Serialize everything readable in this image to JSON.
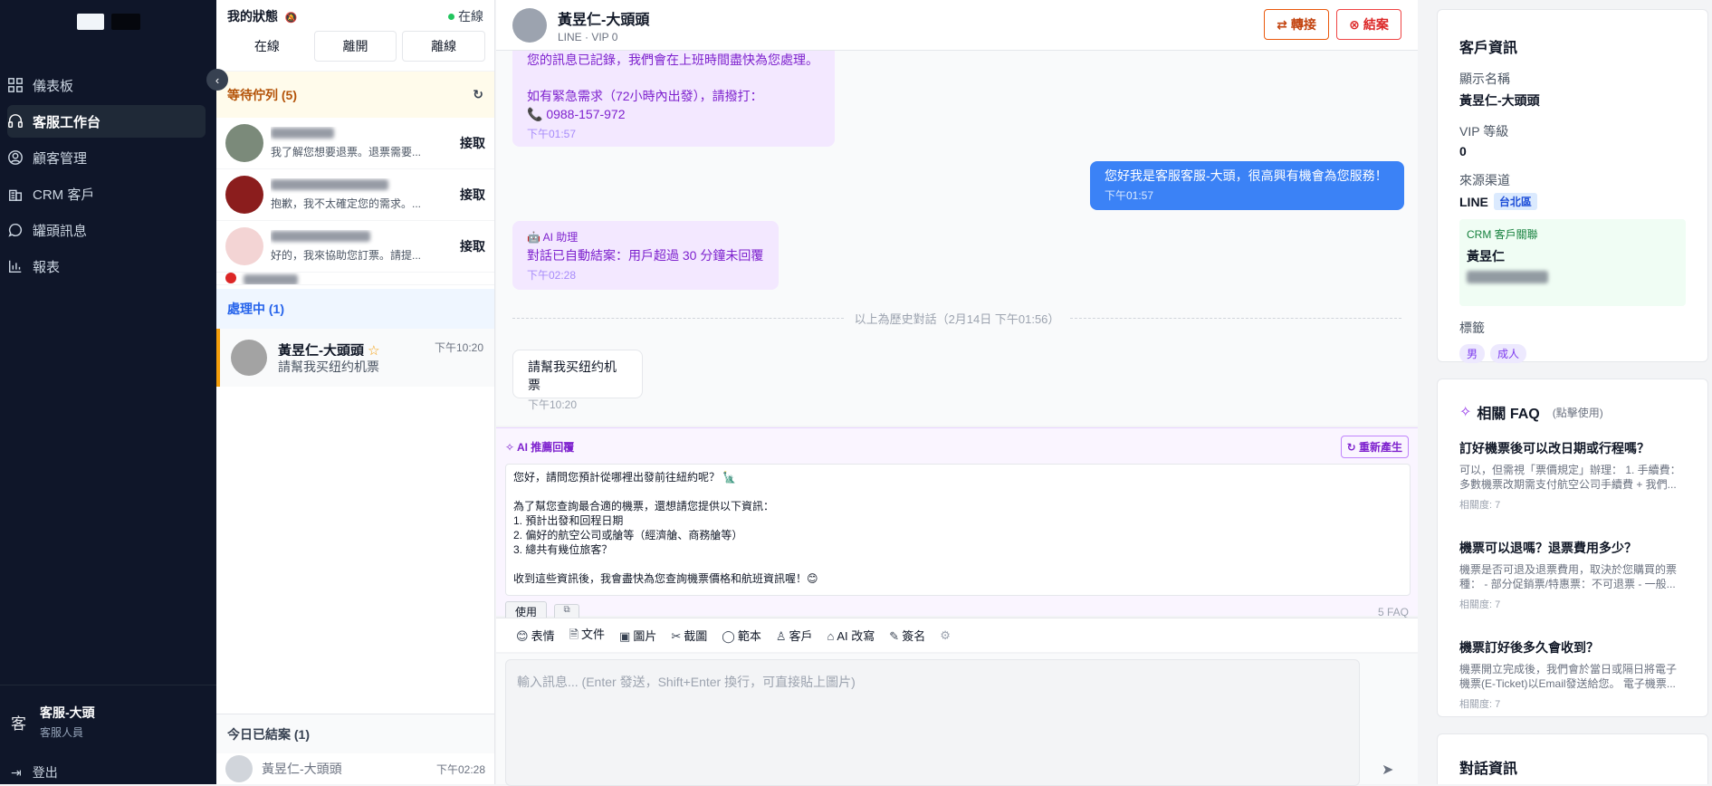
{
  "nav": {
    "items": [
      {
        "label": "儀表板",
        "icon": "dashboard-icon"
      },
      {
        "label": "客服工作台",
        "icon": "headset-icon"
      },
      {
        "label": "顧客管理",
        "icon": "user-circle-icon"
      },
      {
        "label": "CRM 客戶",
        "icon": "building-icon"
      },
      {
        "label": "罐頭訊息",
        "icon": "chat-bubble-icon"
      },
      {
        "label": "報表",
        "icon": "bar-chart-icon"
      }
    ],
    "agent": {
      "avatar_char": "客",
      "name": "客服-大頭",
      "role": "客服人員"
    },
    "logout_label": "登出"
  },
  "queue": {
    "status_label": "我的狀態",
    "online_label": "在線",
    "status_buttons": [
      "在線",
      "離開",
      "離線"
    ],
    "waiting_title": "等待佇列 (5)",
    "waiting": [
      {
        "message": "我了解您想要退票。退票需要...",
        "action": "接取"
      },
      {
        "message": "抱歉，我不太確定您的需求。...",
        "action": "接取"
      },
      {
        "message": "好的，我來協助您訂票。請提...",
        "action": "接取"
      }
    ],
    "processing_title": "處理中 (1)",
    "processing": {
      "name": "黃昱仁-大頭頭",
      "message": "請幫我买纽约机票",
      "time": "下午10:20"
    },
    "done_title": "今日已結案 (1)",
    "done": {
      "name": "黃昱仁-大頭頭",
      "time": "下午02:28"
    }
  },
  "chat": {
    "header": {
      "name": "黃昱仁-大頭頭",
      "sub": "LINE · VIP 0",
      "transfer_label": "轉接",
      "end_label": "結案"
    },
    "messages": {
      "m1_line1": "您的訊息已記錄，我們會在上班時間盡快為您處理。",
      "m1_line2": "如有緊急需求（72小時內出發），請撥打：",
      "m1_line3": "📞 0988-157-972",
      "m1_time": "下午01:57",
      "m2_text": "您好我是客服客服-大頭，很高興有機會為您服務！",
      "m2_time": "下午01:57",
      "m3_label": "🤖 AI 助理",
      "m3_text": "對話已自動結案：用戶超過 30 分鐘未回覆",
      "m3_time": "下午02:28",
      "history_label": "以上為歷史對話（2月14日 下午01:56）",
      "m4_text": "請幫我买纽约机票",
      "m4_time": "下午10:20"
    },
    "ai": {
      "title": "AI 推薦回覆",
      "regen_label": "重新產生",
      "text": "您好，請問您預計從哪裡出發前往紐約呢？ 🗽\n\n為了幫您查詢最合適的機票，還想請您提供以下資訊：\n1. 預計出發和回程日期\n2. 偏好的航空公司或艙等（經濟艙、商務艙等）\n3. 總共有幾位旅客？\n\n收到這些資訊後，我會盡快為您查詢機票價格和航班資訊喔！😊",
      "use_label": "使用",
      "faq_count": "5 FAQ"
    },
    "tools": [
      {
        "icon": "emoji-icon",
        "glyph": "😊",
        "label": "表情"
      },
      {
        "icon": "file-icon",
        "glyph": "🗎",
        "label": "文件"
      },
      {
        "icon": "image-icon",
        "glyph": "▣",
        "label": "圖片"
      },
      {
        "icon": "scissors-icon",
        "glyph": "✂",
        "label": "截圖"
      },
      {
        "icon": "template-icon",
        "glyph": "◯",
        "label": "範本"
      },
      {
        "icon": "customer-icon",
        "glyph": "♙",
        "label": "客戶"
      },
      {
        "icon": "ai-improve-icon",
        "glyph": "⌂",
        "label": "AI 改寫"
      },
      {
        "icon": "signature-icon",
        "glyph": "✎",
        "label": "簽名"
      }
    ],
    "input_placeholder": "輸入訊息... (Enter 發送，Shift+Enter 換行，可直接貼上圖片)"
  },
  "customer": {
    "title": "客戶資訊",
    "display_name_label": "顯示名稱",
    "display_name": "黃昱仁-大頭頭",
    "vip_label": "VIP 等級",
    "vip": "0",
    "source_label": "來源渠道",
    "source": "LINE",
    "region": "台北區",
    "crm_label": "CRM 客戶關聯",
    "crm_name": "黃昱仁",
    "tags_label": "標籤",
    "tags": [
      "男",
      "成人"
    ]
  },
  "faq": {
    "title": "相關 FAQ",
    "hint": "(點擊使用)",
    "items": [
      {
        "q": "訂好機票後可以改日期或行程嗎？",
        "a": "可以，但需視「票價規定」辦理： 1. 手續費：多數機票改期需支付航空公司手續費 + 我們...",
        "r": "相關度: 7"
      },
      {
        "q": "機票可以退嗎？退票費用多少？",
        "a": "機票是否可退及退票費用，取決於您購買的票種： - 部分促銷票/特惠票：不可退票 - 一般...",
        "r": "相關度: 7"
      },
      {
        "q": "機票訂好後多久會收到？",
        "a": "機票開立完成後，我們會於當日或隔日將電子機票(E-Ticket)以Email發送給您。 電子機票...",
        "r": "相關度: 7"
      }
    ]
  },
  "convo": {
    "title": "對話資訊"
  }
}
